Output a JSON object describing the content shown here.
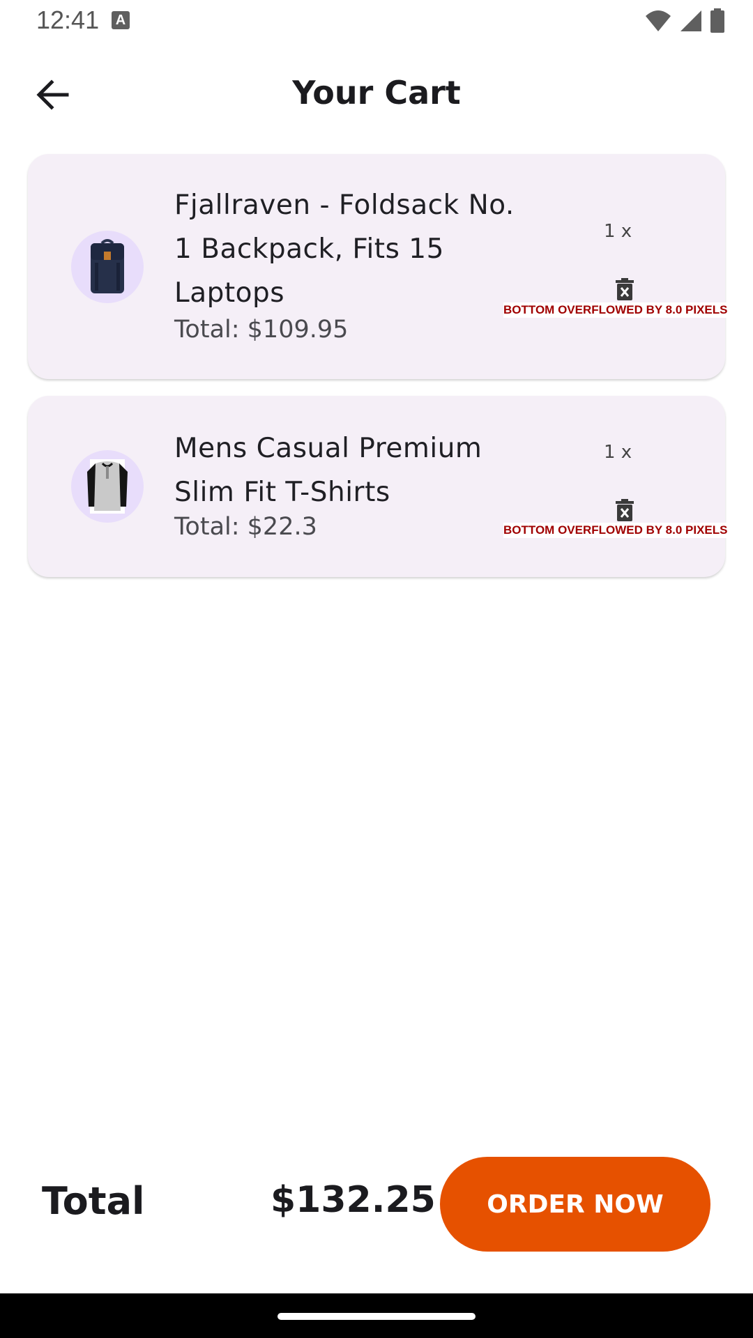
{
  "status_bar": {
    "time": "12:41",
    "notification_letter": "A"
  },
  "header": {
    "title": "Your Cart"
  },
  "cart_items": [
    {
      "name": "Fjallraven - Foldsack No. 1 Backpack, Fits 15 Laptops",
      "total": "Total: $109.95",
      "quantity": "1 x",
      "overflow_warning": "BOTTOM OVERFLOWED BY 8.0 PIXELS"
    },
    {
      "name": "Mens Casual Premium Slim Fit T-Shirts",
      "total": "Total: $22.3",
      "quantity": "1 x",
      "overflow_warning": "BOTTOM OVERFLOWED BY 8.0 PIXELS"
    }
  ],
  "footer": {
    "total_label": "Total",
    "total_amount": "$132.25",
    "order_button": "ORDER NOW"
  },
  "colors": {
    "card_bg": "#f5eff7",
    "thumb_bg": "#e8ddfb",
    "accent": "#e65100",
    "overflow_text": "#a00000"
  }
}
